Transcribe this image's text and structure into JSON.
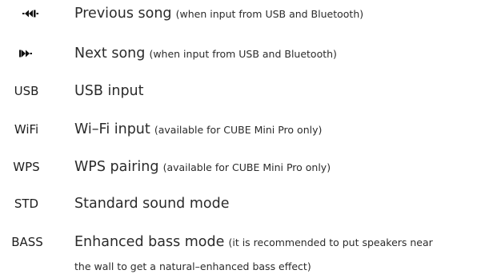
{
  "rows": [
    {
      "icon": "previous-track-icon",
      "main": "Previous song",
      "note": "(when input from USB and Bluetooth)"
    },
    {
      "icon": "next-track-icon",
      "main": "Next song",
      "note": "(when input from USB and Bluetooth)"
    },
    {
      "label": "USB",
      "main": "USB input",
      "note": ""
    },
    {
      "label": "WiFi",
      "main": "Wi–Fi input",
      "note": "(available for CUBE Mini Pro only)"
    },
    {
      "label": "WPS",
      "main": "WPS pairing",
      "note": "(available for CUBE Mini Pro only)"
    },
    {
      "label": "STD",
      "main": "Standard sound mode",
      "note": ""
    },
    {
      "label": "BASS",
      "main": "Enhanced bass mode",
      "note": "(it is recommended to put speakers near",
      "continuation": "the wall to get a natural–enhanced bass effect)"
    }
  ],
  "colors": {
    "text": "#2b2b2b",
    "icon": "#111111"
  }
}
